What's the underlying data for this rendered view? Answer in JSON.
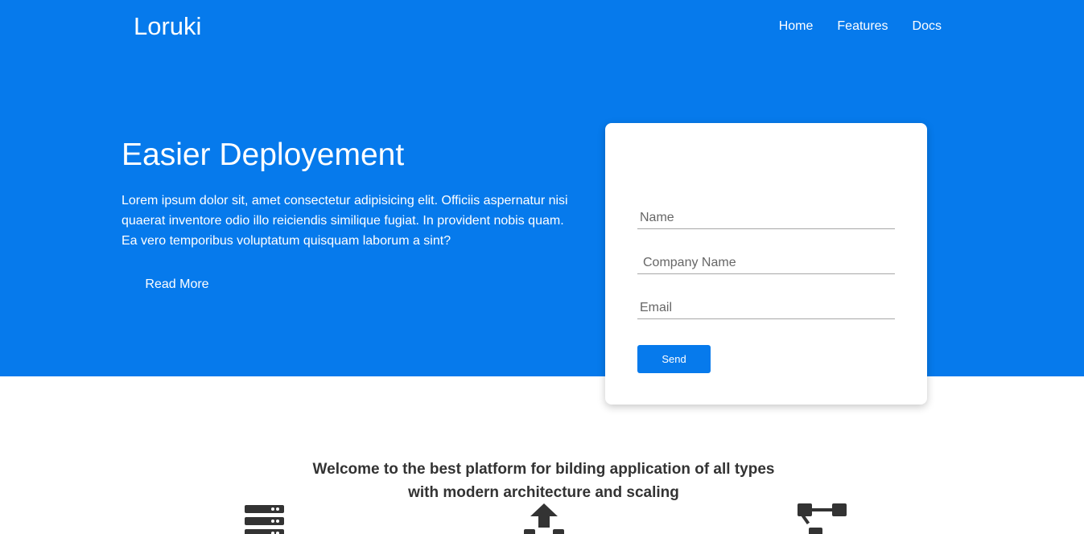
{
  "brand": "Loruki",
  "nav": {
    "home": "Home",
    "features": "Features",
    "docs": "Docs"
  },
  "hero": {
    "title": "Easier Deployement",
    "text": "Lorem ipsum dolor sit, amet consectetur adipisicing elit. Officiis aspernatur nisi quaerat inventore odio illo reiciendis similique fugiat. In provident nobis quam. Ea vero temporibus voluptatum quisquam laborum a sint?",
    "read_more": "Read More"
  },
  "form": {
    "name_placeholder": "Name",
    "company_placeholder": "Company Name",
    "email_placeholder": "Email",
    "send_label": "Send"
  },
  "welcome": {
    "text": "Welcome to the best platform for bilding application of all types with modern architecture and scaling"
  },
  "features": {
    "icons": [
      "server-icon",
      "upload-icon",
      "network-icon"
    ]
  },
  "colors": {
    "primary": "#067aec",
    "text_dark": "#333333",
    "card_bg": "#ffffff"
  }
}
